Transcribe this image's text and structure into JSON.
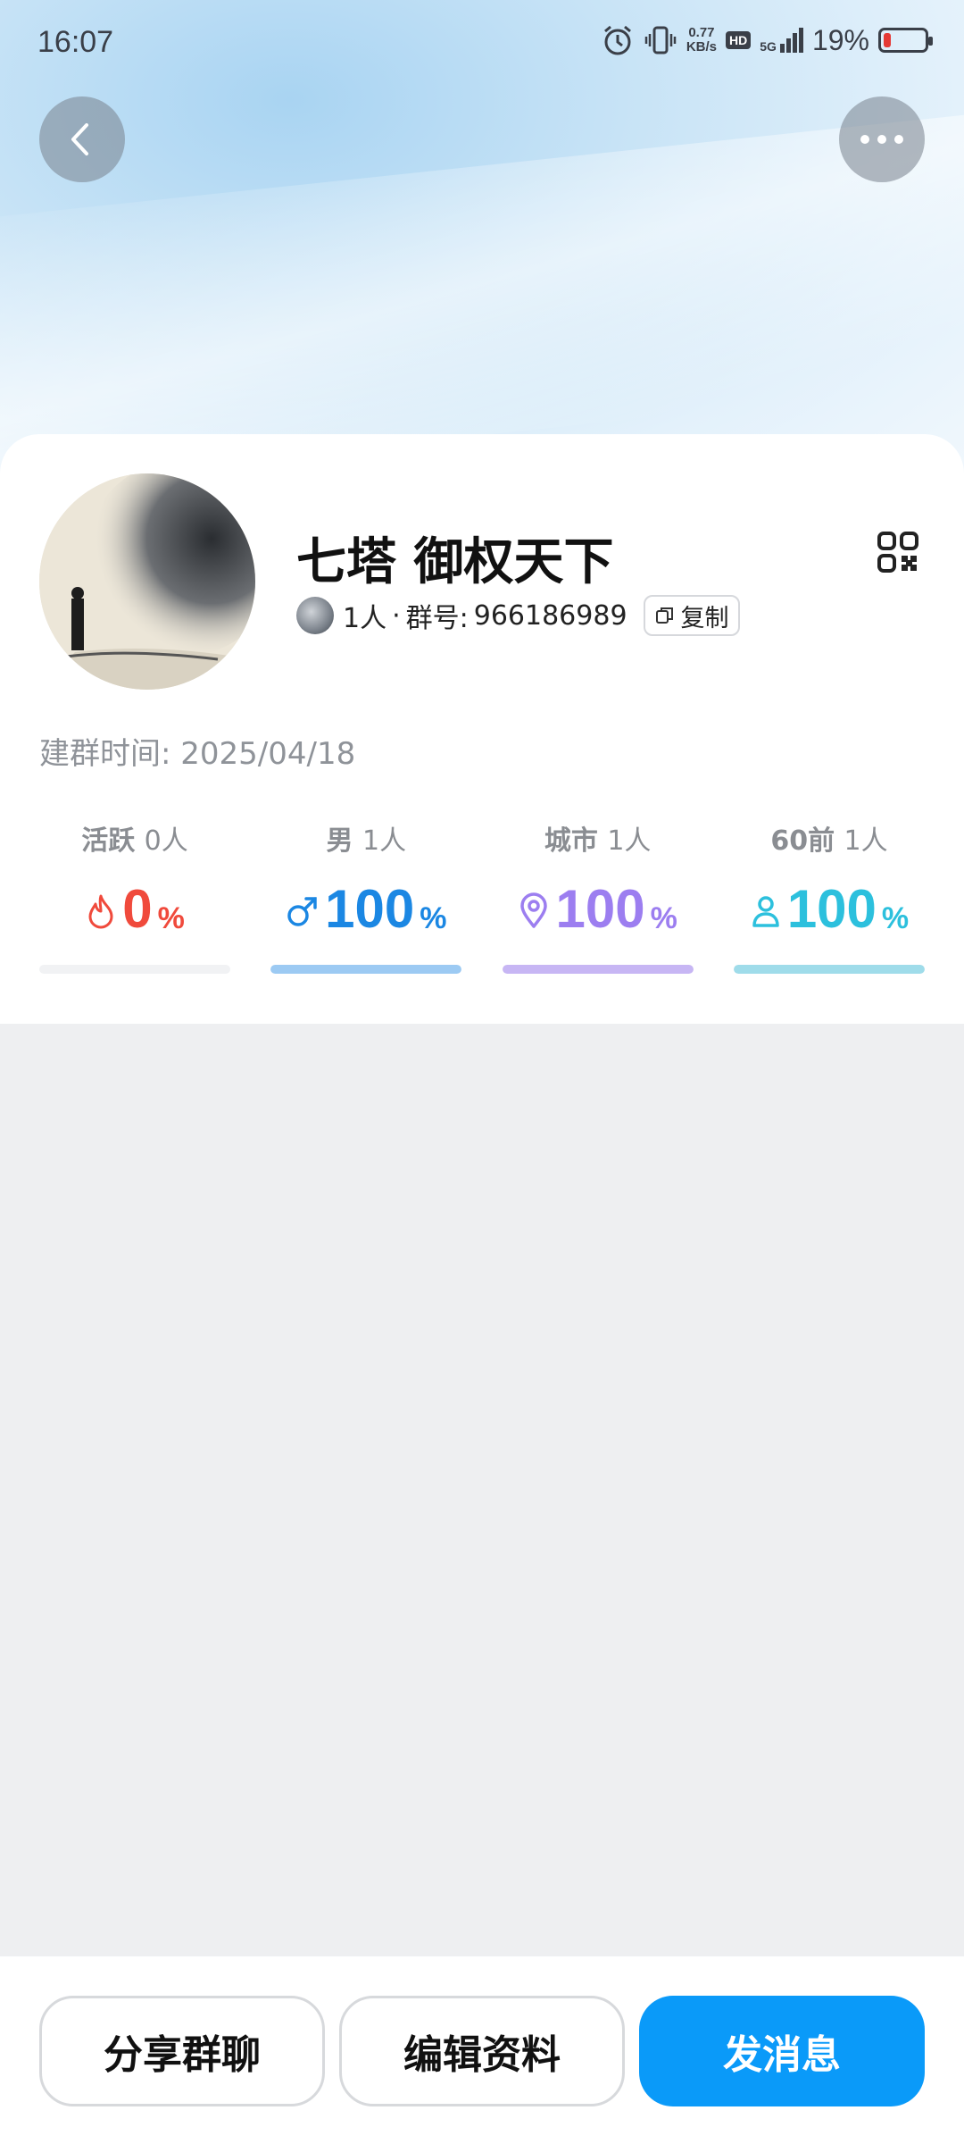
{
  "status": {
    "time": "16:07",
    "net_speed_top": "0.77",
    "net_speed_bottom": "KB/s",
    "hd": "HD",
    "signal": "5G",
    "battery": "19%",
    "battery_level": 0.19
  },
  "group": {
    "name": "七塔 御权天下",
    "member_count": "1人",
    "separator": "·",
    "id_label": "群号:",
    "id": "966186989",
    "copy_label": "复制",
    "created_label": "建群时间:",
    "created_date": "2025/04/18"
  },
  "stats": [
    {
      "label": "活跃",
      "count": "0人",
      "value": "0",
      "pct": "%",
      "icon": "flame-icon",
      "color": "#f04a3c",
      "bar_color": "#f1f2f4",
      "level": 0
    },
    {
      "label": "男",
      "count": "1人",
      "value": "100",
      "pct": "%",
      "icon": "male-icon",
      "color": "#1b87e3",
      "bar_color": "#9ccaf3",
      "level": 1
    },
    {
      "label": "城市",
      "count": "1人",
      "value": "100",
      "pct": "%",
      "icon": "location-pin-icon",
      "color": "#9c7ef0",
      "bar_color": "#c7b6f4",
      "level": 1
    },
    {
      "label": "60前",
      "count": "1人",
      "value": "100",
      "pct": "%",
      "icon": "person-icon",
      "color": "#2cc0dd",
      "bar_color": "#9fdcea",
      "level": 1
    }
  ],
  "actions": {
    "share": "分享群聊",
    "edit": "编辑资料",
    "message": "发消息"
  }
}
